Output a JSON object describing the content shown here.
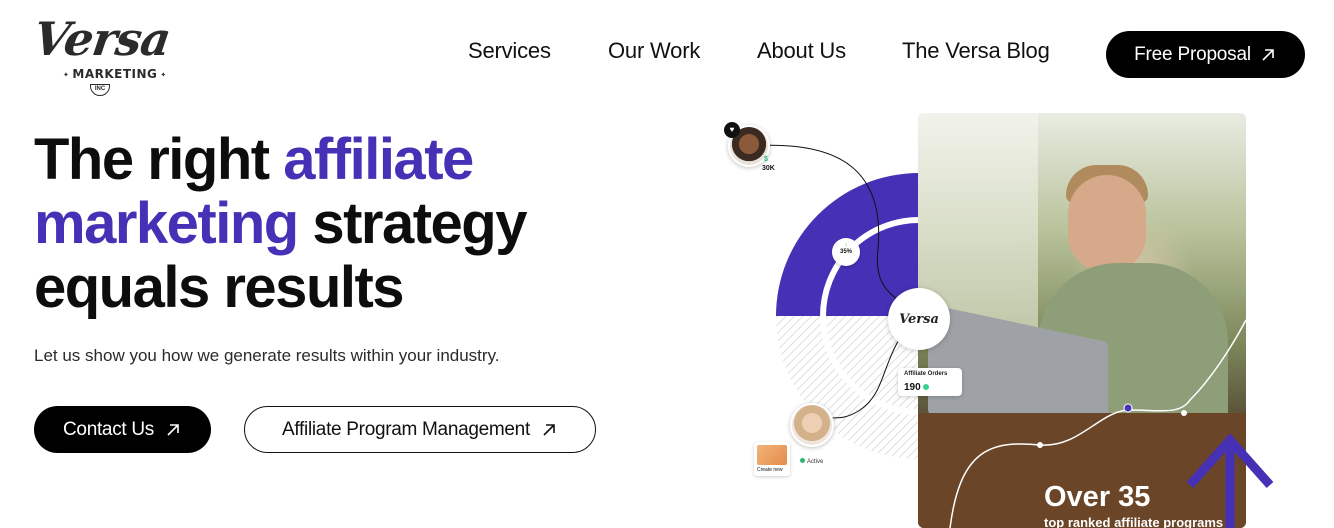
{
  "logo": {
    "script": "Versa",
    "sub": "MARKETING",
    "inc": "INC"
  },
  "nav": {
    "items": [
      {
        "label": "Services"
      },
      {
        "label": "Our Work"
      },
      {
        "label": "About Us"
      },
      {
        "label": "The Versa Blog"
      }
    ],
    "cta_label": "Free Proposal"
  },
  "hero": {
    "headline_1": "The right ",
    "headline_accent_1": "affiliate",
    "headline_accent_2": "marketing",
    "headline_2": " strategy",
    "headline_3": "equals results",
    "subtext": "Let us show you how we generate results within your industry.",
    "primary_button": "Contact Us",
    "secondary_button": "Affiliate Program Management"
  },
  "graphic": {
    "earnings_symbol": "$",
    "earnings_value": "30K",
    "growth_percent": "35%",
    "badge_text": "Versa",
    "orders_label": "Affiliate Orders",
    "orders_value": "190",
    "create_label": "Create new",
    "active_label": "Active",
    "stat_big": "Over 35",
    "stat_small": "top ranked affiliate programs"
  },
  "colors": {
    "accent": "#4630b5",
    "dark": "#000000"
  }
}
